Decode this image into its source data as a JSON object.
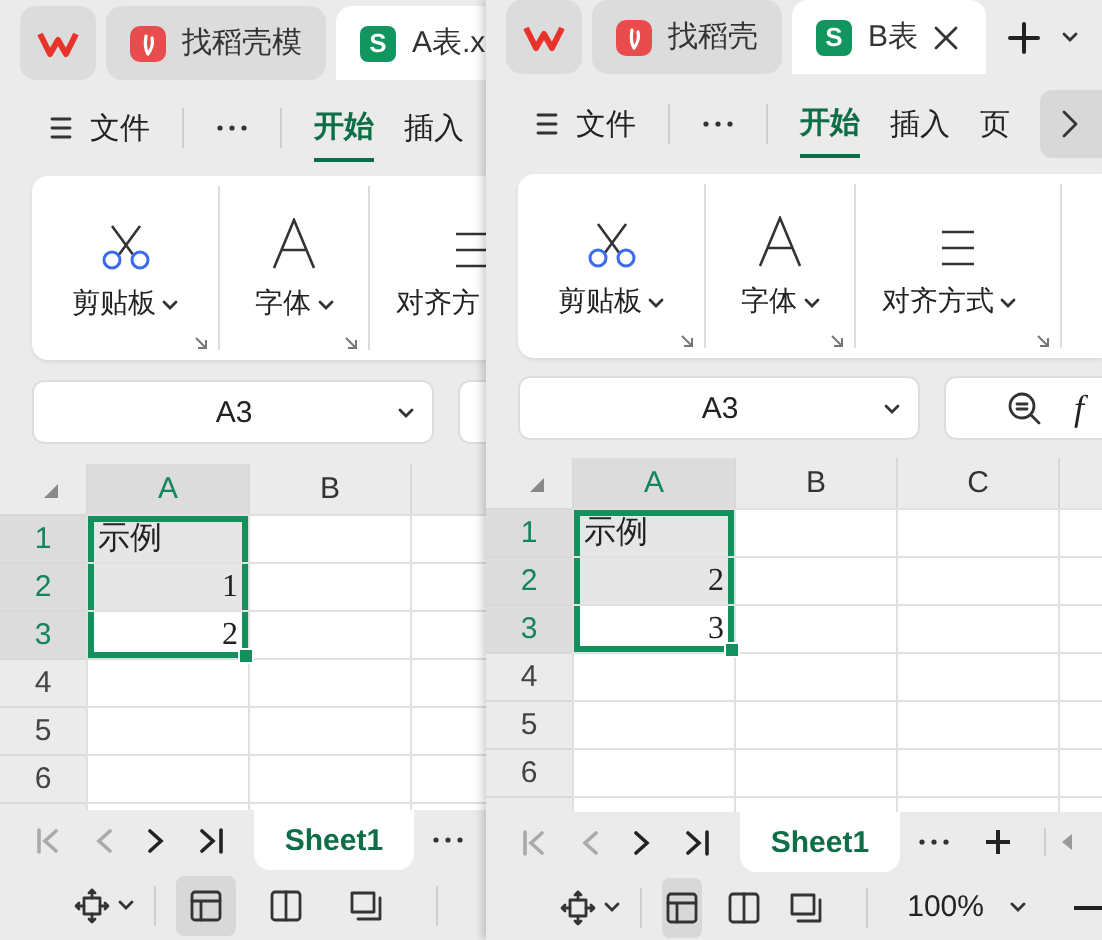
{
  "windows": [
    {
      "tabs": [
        {
          "kind": "home",
          "selected": false
        },
        {
          "kind": "docer",
          "label": "找稻壳模",
          "selected": false
        },
        {
          "kind": "sheet",
          "badge": "S",
          "label": "A表.x",
          "selected": true,
          "closable": false
        }
      ],
      "menu": [
        {
          "kind": "file",
          "label": "文件"
        },
        {
          "kind": "more"
        },
        {
          "kind": "tab",
          "label": "开始",
          "selected": true
        },
        {
          "kind": "tab",
          "label": "插入",
          "selected": false
        }
      ],
      "ribbon": [
        {
          "kind": "clipboard",
          "label": "剪贴板",
          "dropdown": true,
          "launcher": true
        },
        {
          "kind": "font",
          "label": "字体",
          "dropdown": true,
          "launcher": true
        },
        {
          "kind": "align",
          "label": "对齐方"
        }
      ],
      "name_box": "A3",
      "columns": [
        {
          "label": "A",
          "selected": true
        },
        {
          "label": "B",
          "selected": false
        }
      ],
      "rows": [
        {
          "header": "1",
          "selected": true,
          "cells": [
            {
              "text": "示例",
              "kind": "text",
              "in_selection": true,
              "active": false
            }
          ]
        },
        {
          "header": "2",
          "selected": true,
          "cells": [
            {
              "text": "1",
              "kind": "number",
              "in_selection": true,
              "active": false
            }
          ]
        },
        {
          "header": "3",
          "selected": true,
          "cells": [
            {
              "text": "2",
              "kind": "number",
              "in_selection": true,
              "active": true
            }
          ]
        },
        {
          "header": "4",
          "selected": false,
          "cells": []
        },
        {
          "header": "5",
          "selected": false,
          "cells": []
        },
        {
          "header": "6",
          "selected": false,
          "cells": []
        }
      ],
      "sheet_nav": [
        {
          "kind": "first",
          "disabled": true
        },
        {
          "kind": "prev",
          "disabled": true
        },
        {
          "kind": "next",
          "disabled": false
        },
        {
          "kind": "last",
          "disabled": false
        }
      ],
      "sheet_tabs": [
        {
          "label": "Sheet1",
          "selected": true
        }
      ],
      "sheet_actions": [
        {
          "kind": "more"
        }
      ],
      "views": [
        {
          "kind": "normal",
          "selected": true
        },
        {
          "kind": "break",
          "selected": false
        },
        {
          "kind": "layout",
          "selected": false
        }
      ]
    },
    {
      "tabs": [
        {
          "kind": "home",
          "selected": false
        },
        {
          "kind": "docer",
          "label": "找稻壳",
          "selected": false
        },
        {
          "kind": "sheet",
          "badge": "S",
          "label": "B表",
          "selected": true,
          "closable": true
        },
        {
          "kind": "new"
        },
        {
          "kind": "list"
        }
      ],
      "menu": [
        {
          "kind": "file",
          "label": "文件"
        },
        {
          "kind": "more"
        },
        {
          "kind": "tab",
          "label": "开始",
          "selected": true
        },
        {
          "kind": "tab",
          "label": "插入",
          "selected": false
        },
        {
          "kind": "tab",
          "label": "页",
          "selected": false
        },
        {
          "kind": "scroll"
        }
      ],
      "ribbon": [
        {
          "kind": "clipboard",
          "label": "剪贴板",
          "dropdown": true,
          "launcher": true
        },
        {
          "kind": "font",
          "label": "字体",
          "dropdown": true,
          "launcher": true
        },
        {
          "kind": "align",
          "label": "对齐方式",
          "dropdown": true,
          "launcher": true
        }
      ],
      "name_box": "A3",
      "formula_label": "f",
      "columns": [
        {
          "label": "A",
          "selected": true
        },
        {
          "label": "B",
          "selected": false
        },
        {
          "label": "C",
          "selected": false
        }
      ],
      "rows": [
        {
          "header": "1",
          "selected": true,
          "cells": [
            {
              "text": "示例",
              "kind": "text",
              "in_selection": true,
              "active": false
            }
          ]
        },
        {
          "header": "2",
          "selected": true,
          "cells": [
            {
              "text": "2",
              "kind": "number",
              "in_selection": true,
              "active": false
            }
          ]
        },
        {
          "header": "3",
          "selected": true,
          "cells": [
            {
              "text": "3",
              "kind": "number",
              "in_selection": true,
              "active": true
            }
          ]
        },
        {
          "header": "4",
          "selected": false,
          "cells": []
        },
        {
          "header": "5",
          "selected": false,
          "cells": []
        },
        {
          "header": "6",
          "selected": false,
          "cells": []
        }
      ],
      "sheet_nav": [
        {
          "kind": "first",
          "disabled": true
        },
        {
          "kind": "prev",
          "disabled": true
        },
        {
          "kind": "next",
          "disabled": false
        },
        {
          "kind": "last",
          "disabled": false
        }
      ],
      "sheet_tabs": [
        {
          "label": "Sheet1",
          "selected": true
        }
      ],
      "sheet_actions": [
        {
          "kind": "more"
        },
        {
          "kind": "add"
        },
        {
          "kind": "scroll"
        }
      ],
      "views": [
        {
          "kind": "normal",
          "selected": true
        },
        {
          "kind": "break",
          "selected": false
        },
        {
          "kind": "layout",
          "selected": false
        }
      ],
      "zoom": "100%"
    }
  ]
}
